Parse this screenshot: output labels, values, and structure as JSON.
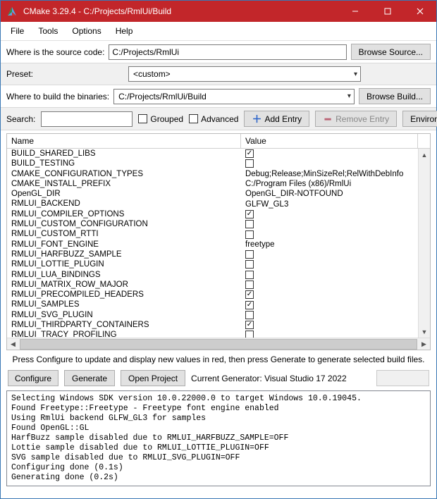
{
  "window": {
    "title": "CMake 3.29.4 - C:/Projects/RmlUi/Build"
  },
  "menu": {
    "file": "File",
    "tools": "Tools",
    "options": "Options",
    "help": "Help"
  },
  "source": {
    "label": "Where is the source code:",
    "value": "C:/Projects/RmlUi",
    "browse": "Browse Source..."
  },
  "preset": {
    "label": "Preset:",
    "value": "<custom>"
  },
  "build": {
    "label": "Where to build the binaries:",
    "value": "C:/Projects/RmlUi/Build",
    "browse": "Browse Build..."
  },
  "toolbar": {
    "search_label": "Search:",
    "grouped": "Grouped",
    "advanced": "Advanced",
    "add_entry": "Add Entry",
    "remove_entry": "Remove Entry",
    "environment": "Environment..."
  },
  "table": {
    "col_name": "Name",
    "col_value": "Value",
    "rows": [
      {
        "name": "BUILD_SHARED_LIBS",
        "type": "check",
        "checked": true
      },
      {
        "name": "BUILD_TESTING",
        "type": "check",
        "checked": false
      },
      {
        "name": "CMAKE_CONFIGURATION_TYPES",
        "type": "text",
        "value": "Debug;Release;MinSizeRel;RelWithDebInfo"
      },
      {
        "name": "CMAKE_INSTALL_PREFIX",
        "type": "text",
        "value": "C:/Program Files (x86)/RmlUi"
      },
      {
        "name": "OpenGL_DIR",
        "type": "text",
        "value": "OpenGL_DIR-NOTFOUND"
      },
      {
        "name": "RMLUI_BACKEND",
        "type": "text",
        "value": "GLFW_GL3"
      },
      {
        "name": "RMLUI_COMPILER_OPTIONS",
        "type": "check",
        "checked": true
      },
      {
        "name": "RMLUI_CUSTOM_CONFIGURATION",
        "type": "check",
        "checked": false
      },
      {
        "name": "RMLUI_CUSTOM_RTTI",
        "type": "check",
        "checked": false
      },
      {
        "name": "RMLUI_FONT_ENGINE",
        "type": "text",
        "value": "freetype"
      },
      {
        "name": "RMLUI_HARFBUZZ_SAMPLE",
        "type": "check",
        "checked": false
      },
      {
        "name": "RMLUI_LOTTIE_PLUGIN",
        "type": "check",
        "checked": false
      },
      {
        "name": "RMLUI_LUA_BINDINGS",
        "type": "check",
        "checked": false
      },
      {
        "name": "RMLUI_MATRIX_ROW_MAJOR",
        "type": "check",
        "checked": false
      },
      {
        "name": "RMLUI_PRECOMPILED_HEADERS",
        "type": "check",
        "checked": true
      },
      {
        "name": "RMLUI_SAMPLES",
        "type": "check",
        "checked": true
      },
      {
        "name": "RMLUI_SVG_PLUGIN",
        "type": "check",
        "checked": false
      },
      {
        "name": "RMLUI_THIRDPARTY_CONTAINERS",
        "type": "check",
        "checked": true
      },
      {
        "name": "RMLUI_TRACY_PROFILING",
        "type": "check",
        "checked": false
      }
    ]
  },
  "hint": "Press Configure to update and display new values in red, then press Generate to generate selected build files.",
  "actions": {
    "configure": "Configure",
    "generate": "Generate",
    "open_project": "Open Project",
    "generator_label": "Current Generator: Visual Studio 17 2022"
  },
  "output": "Selecting Windows SDK version 10.0.22000.0 to target Windows 10.0.19045.\nFound Freetype::Freetype - Freetype font engine enabled\nUsing RmlUi backend GLFW_GL3 for samples\nFound OpenGL::GL\nHarfBuzz sample disabled due to RMLUI_HARFBUZZ_SAMPLE=OFF\nLottie sample disabled due to RMLUI_LOTTIE_PLUGIN=OFF\nSVG sample disabled due to RMLUI_SVG_PLUGIN=OFF\nConfiguring done (0.1s)\nGenerating done (0.2s)"
}
